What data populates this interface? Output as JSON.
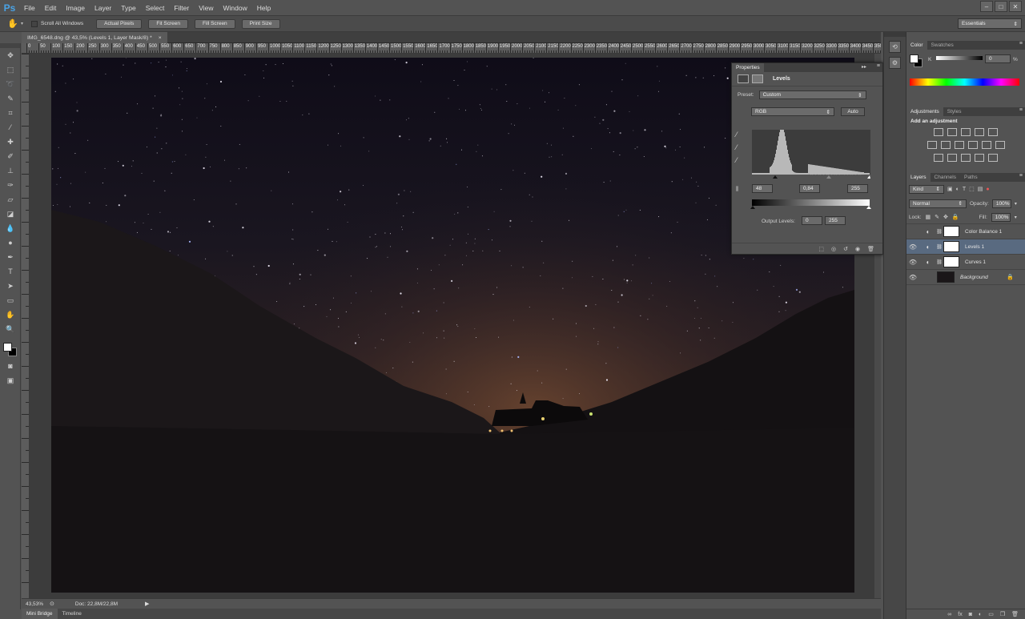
{
  "app": {
    "logo": "Ps"
  },
  "menu": [
    "File",
    "Edit",
    "Image",
    "Layer",
    "Type",
    "Select",
    "Filter",
    "View",
    "Window",
    "Help"
  ],
  "window_buttons": [
    "–",
    "□",
    "✕"
  ],
  "options_bar": {
    "scroll_all_label": "Scroll All Windows",
    "buttons": [
      "Actual Pixels",
      "Fit Screen",
      "Fill Screen",
      "Print Size"
    ],
    "workspace": "Essentials"
  },
  "document": {
    "tab_title": "IMG_6548.dng @ 43,5% (Levels 1, Layer Mask/8) *",
    "close": "×"
  },
  "ruler_top": [
    "0",
    "50",
    "100",
    "150",
    "200",
    "250",
    "300",
    "350",
    "400",
    "450",
    "500",
    "550",
    "600",
    "650",
    "700",
    "750",
    "800",
    "850",
    "900",
    "950",
    "1000",
    "1050",
    "1100",
    "1150",
    "1200",
    "1250",
    "1300",
    "1350",
    "1400",
    "1450",
    "1500",
    "1550",
    "1600",
    "1650",
    "1700",
    "1750",
    "1800",
    "1850",
    "1900",
    "1950",
    "2000",
    "2050",
    "2100",
    "2150",
    "2200",
    "2250",
    "2300",
    "2350",
    "2400",
    "2450",
    "2500",
    "2550",
    "2600",
    "2650",
    "2700",
    "2750",
    "2800",
    "2850",
    "2900",
    "2950",
    "3000",
    "3050",
    "3100",
    "3150",
    "3200",
    "3250",
    "3300",
    "3350",
    "3400",
    "3450",
    "350"
  ],
  "status": {
    "zoom": "43,53%",
    "doc": "Doc: 22,8M/22,8M"
  },
  "bottom_tabs": [
    "Mini Bridge",
    "Timeline"
  ],
  "properties": {
    "title": "Properties",
    "adj_name": "Levels",
    "preset_label": "Preset:",
    "preset_value": "Custom",
    "channel": "RGB",
    "auto_label": "Auto",
    "input_black": "48",
    "input_gamma": "0,84",
    "input_white": "255",
    "output_label": "Output Levels:",
    "output_black": "0",
    "output_white": "255"
  },
  "color_panel": {
    "tabs": [
      "Color",
      "Swatches"
    ],
    "channel": "K",
    "value": "0",
    "unit": "%"
  },
  "adjustments_panel": {
    "tabs": [
      "Adjustments",
      "Styles"
    ],
    "heading": "Add an adjustment"
  },
  "layers_panel": {
    "tabs": [
      "Layers",
      "Channels",
      "Paths"
    ],
    "kind": "Kind",
    "blend_mode": "Normal",
    "opacity_label": "Opacity:",
    "opacity": "100%",
    "lock_label": "Lock:",
    "fill_label": "Fill:",
    "fill": "100%",
    "layers": [
      {
        "name": "Color Balance 1",
        "visible": false,
        "selected": false
      },
      {
        "name": "Levels 1",
        "visible": true,
        "selected": true
      },
      {
        "name": "Curves 1",
        "visible": true,
        "selected": false
      },
      {
        "name": "Background",
        "visible": true,
        "selected": false
      }
    ],
    "footer_icons": [
      "link-icon",
      "fx-icon",
      "mask-icon",
      "adjustment-icon",
      "folder-icon",
      "new-layer-icon",
      "trash-icon"
    ]
  },
  "tools": [
    "move-tool",
    "marquee-tool",
    "lasso-tool",
    "quick-select-tool",
    "crop-tool",
    "eyedropper-tool",
    "healing-tool",
    "brush-tool",
    "clone-stamp-tool",
    "history-brush-tool",
    "eraser-tool",
    "gradient-tool",
    "blur-tool",
    "dodge-tool",
    "pen-tool",
    "type-tool",
    "path-select-tool",
    "shape-tool",
    "hand-tool",
    "zoom-tool"
  ]
}
